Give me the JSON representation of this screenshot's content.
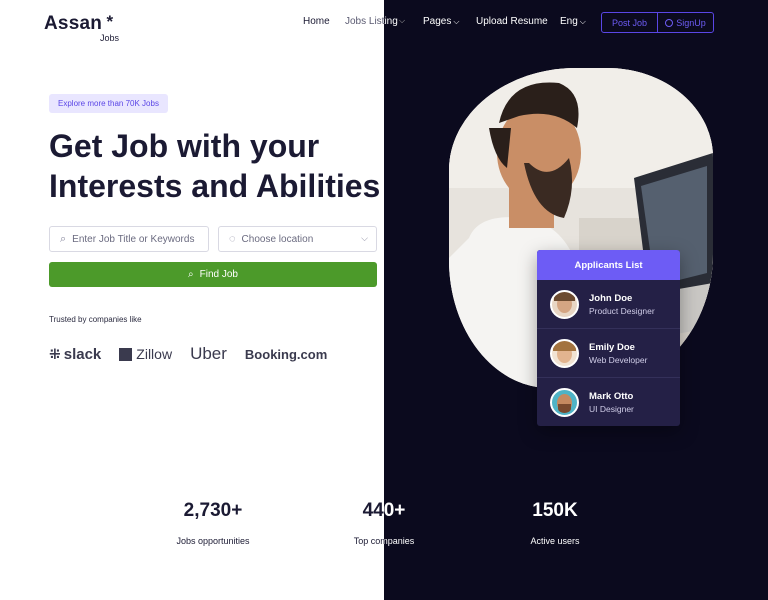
{
  "brand": {
    "name": "Assan",
    "star": "*",
    "sub": "Jobs"
  },
  "nav": {
    "items": [
      {
        "label": "Home"
      },
      {
        "label": "Jobs Listing"
      },
      {
        "label": "Pages"
      },
      {
        "label": "Upload Resume"
      },
      {
        "label": "Eng"
      }
    ],
    "post_job": "Post Job",
    "signup": "SignUp"
  },
  "hero": {
    "badge": "Explore more than 70K Jobs",
    "title_line1": "Get Job with your",
    "title_line2": "Interests and Abilities",
    "search_placeholder": "Enter Job Title or Keywords",
    "location_placeholder": "Choose location",
    "find_button": "Find Job",
    "trusted": "Trusted by companies like"
  },
  "companies": [
    "slack",
    "Zillow",
    "Uber",
    "Booking.com"
  ],
  "applicants": {
    "title": "Applicants List",
    "people": [
      {
        "name": "John Doe",
        "role": "Product Designer"
      },
      {
        "name": "Emily Doe",
        "role": "Web Developer"
      },
      {
        "name": "Mark Otto",
        "role": "UI Designer"
      }
    ]
  },
  "stats": [
    {
      "value": "2,730+",
      "label": "Jobs opportunities"
    },
    {
      "value": "440+",
      "label": "Top companies"
    },
    {
      "value": "150K",
      "label": "Active users"
    }
  ],
  "colors": {
    "accent": "#6d5cf5",
    "find": "#4c9a2a",
    "dark_bg": "#0b0a1e",
    "card": "#242046"
  }
}
